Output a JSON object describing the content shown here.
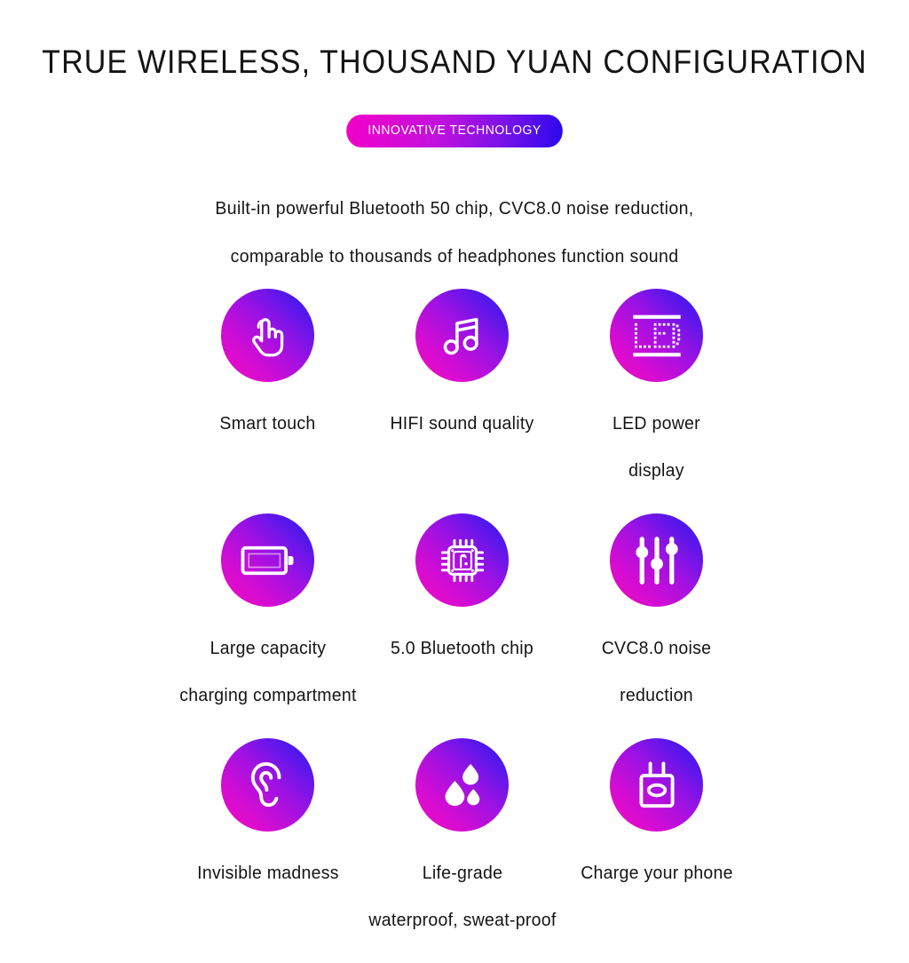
{
  "header": {
    "title": "TRUE WIRELESS,  THOUSAND YUAN CONFIGURATION",
    "badge_label": "INNOVATIVE TECHNOLOGY",
    "subtitle_line1": "Built-in powerful Bluetooth 50 chip,  CVC8.0 noise reduction,",
    "subtitle_line2": "comparable to thousands of headphones function sound"
  },
  "colors": {
    "gradient_start": "#f009c0",
    "gradient_end": "#3a1fe8",
    "badge_start": "#f400c8",
    "badge_end": "#2a07ee",
    "text": "#141414",
    "background": "#ffffff",
    "icon": "#ffffff"
  },
  "features": [
    {
      "icon": "touch-hand-icon",
      "label_line1": "Smart touch",
      "label_line2": ""
    },
    {
      "icon": "music-note-icon",
      "label_line1": "HIFI sound quality",
      "label_line2": ""
    },
    {
      "icon": "led-display-icon",
      "label_line1": "LED power",
      "label_line2": "display"
    },
    {
      "icon": "battery-icon",
      "label_line1": "Large capacity",
      "label_line2": "charging compartment"
    },
    {
      "icon": "chip-icon",
      "label_line1": "5.0 Bluetooth chip",
      "label_line2": ""
    },
    {
      "icon": "equalizer-icon",
      "label_line1": "CVC8.0 noise",
      "label_line2": "reduction"
    },
    {
      "icon": "ear-icon",
      "label_line1": "Invisible madness",
      "label_line2": ""
    },
    {
      "icon": "water-drops-icon",
      "label_line1": "Life-grade",
      "label_line2": "waterproof,  sweat-proof"
    },
    {
      "icon": "power-plug-icon",
      "label_line1": "Charge your phone",
      "label_line2": ""
    }
  ]
}
